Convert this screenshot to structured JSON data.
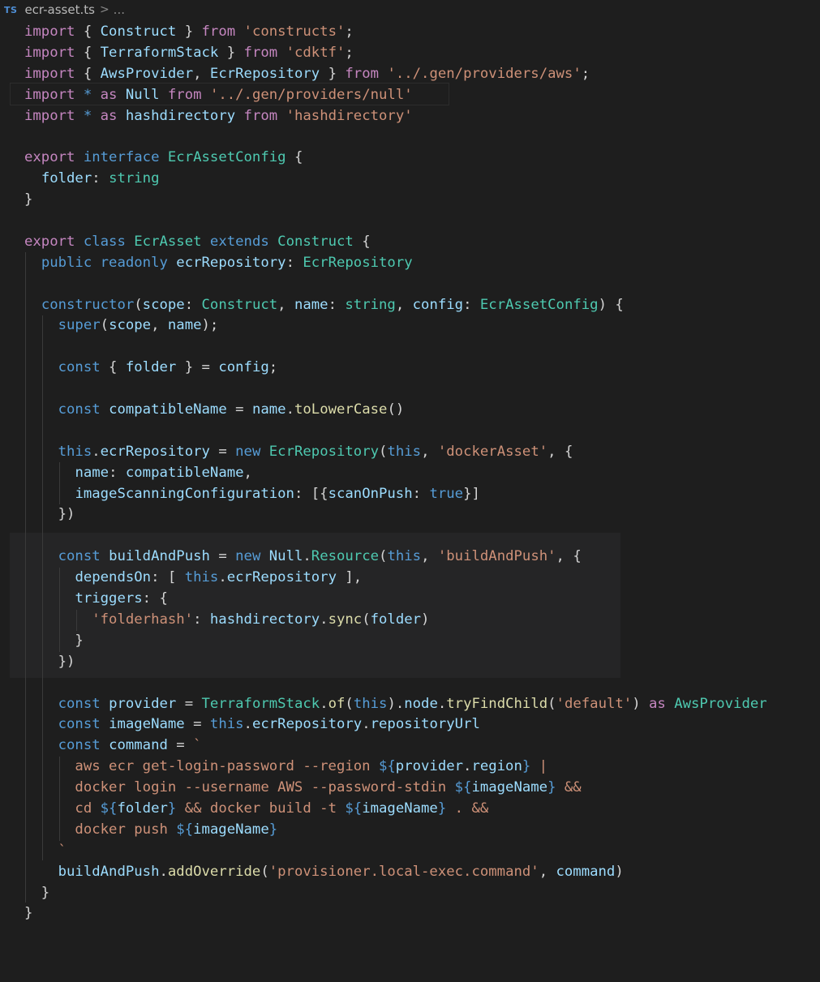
{
  "breadcrumb": {
    "badge": "TS",
    "file": "ecr-asset.ts",
    "separator": ">",
    "more": "..."
  },
  "colors": {
    "background": "#1e1e1e",
    "keyword_control": "#c586c0",
    "keyword": "#569cd6",
    "type": "#4ec9b0",
    "variable": "#9cdcfe",
    "string": "#ce9178",
    "function": "#dcdcaa",
    "punctuation": "#d4d4d4"
  },
  "code": [
    [
      [
        "kw-import",
        "import"
      ],
      [
        "punct",
        " { "
      ],
      [
        "var",
        "Construct"
      ],
      [
        "punct",
        " } "
      ],
      [
        "kw-import",
        "from"
      ],
      [
        "punct",
        " "
      ],
      [
        "str",
        "'constructs'"
      ],
      [
        "punct",
        ";"
      ]
    ],
    [
      [
        "kw-import",
        "import"
      ],
      [
        "punct",
        " { "
      ],
      [
        "var",
        "TerraformStack"
      ],
      [
        "punct",
        " } "
      ],
      [
        "kw-import",
        "from"
      ],
      [
        "punct",
        " "
      ],
      [
        "str",
        "'cdktf'"
      ],
      [
        "punct",
        ";"
      ]
    ],
    [
      [
        "kw-import",
        "import"
      ],
      [
        "punct",
        " { "
      ],
      [
        "var",
        "AwsProvider"
      ],
      [
        "punct",
        ", "
      ],
      [
        "var",
        "EcrRepository"
      ],
      [
        "punct",
        " } "
      ],
      [
        "kw-import",
        "from"
      ],
      [
        "punct",
        " "
      ],
      [
        "str",
        "'../.gen/providers/aws'"
      ],
      [
        "punct",
        ";"
      ]
    ],
    [
      [
        "kw-import",
        "import"
      ],
      [
        "punct",
        " "
      ],
      [
        "kw",
        "*"
      ],
      [
        "punct",
        " "
      ],
      [
        "kw-import",
        "as"
      ],
      [
        "punct",
        " "
      ],
      [
        "var",
        "Null"
      ],
      [
        "punct",
        " "
      ],
      [
        "kw-import",
        "from"
      ],
      [
        "punct",
        " "
      ],
      [
        "str",
        "'../.gen/providers/null'"
      ]
    ],
    [
      [
        "kw-import",
        "import"
      ],
      [
        "punct",
        " "
      ],
      [
        "kw",
        "*"
      ],
      [
        "punct",
        " "
      ],
      [
        "kw-import",
        "as"
      ],
      [
        "punct",
        " "
      ],
      [
        "var",
        "hashdirectory"
      ],
      [
        "punct",
        " "
      ],
      [
        "kw-import",
        "from"
      ],
      [
        "punct",
        " "
      ],
      [
        "str",
        "'hashdirectory'"
      ]
    ],
    [],
    [
      [
        "kw-import",
        "export"
      ],
      [
        "punct",
        " "
      ],
      [
        "kw",
        "interface"
      ],
      [
        "punct",
        " "
      ],
      [
        "type",
        "EcrAssetConfig"
      ],
      [
        "punct",
        " {"
      ]
    ],
    [
      [
        "punct",
        "  "
      ],
      [
        "var",
        "folder"
      ],
      [
        "punct",
        ": "
      ],
      [
        "type",
        "string"
      ]
    ],
    [
      [
        "punct",
        "}"
      ]
    ],
    [],
    [
      [
        "kw-import",
        "export"
      ],
      [
        "punct",
        " "
      ],
      [
        "kw",
        "class"
      ],
      [
        "punct",
        " "
      ],
      [
        "type",
        "EcrAsset"
      ],
      [
        "punct",
        " "
      ],
      [
        "kw",
        "extends"
      ],
      [
        "punct",
        " "
      ],
      [
        "type",
        "Construct"
      ],
      [
        "punct",
        " {"
      ]
    ],
    [
      [
        "punct",
        "  "
      ],
      [
        "kw",
        "public"
      ],
      [
        "punct",
        " "
      ],
      [
        "kw",
        "readonly"
      ],
      [
        "punct",
        " "
      ],
      [
        "var",
        "ecrRepository"
      ],
      [
        "punct",
        ": "
      ],
      [
        "type",
        "EcrRepository"
      ]
    ],
    [],
    [
      [
        "punct",
        "  "
      ],
      [
        "kw",
        "constructor"
      ],
      [
        "punct",
        "("
      ],
      [
        "var",
        "scope"
      ],
      [
        "punct",
        ": "
      ],
      [
        "type",
        "Construct"
      ],
      [
        "punct",
        ", "
      ],
      [
        "var",
        "name"
      ],
      [
        "punct",
        ": "
      ],
      [
        "type",
        "string"
      ],
      [
        "punct",
        ", "
      ],
      [
        "var",
        "config"
      ],
      [
        "punct",
        ": "
      ],
      [
        "type",
        "EcrAssetConfig"
      ],
      [
        "punct",
        ") {"
      ]
    ],
    [
      [
        "punct",
        "    "
      ],
      [
        "kw",
        "super"
      ],
      [
        "punct",
        "("
      ],
      [
        "var",
        "scope"
      ],
      [
        "punct",
        ", "
      ],
      [
        "var",
        "name"
      ],
      [
        "punct",
        ");"
      ]
    ],
    [],
    [
      [
        "punct",
        "    "
      ],
      [
        "kw",
        "const"
      ],
      [
        "punct",
        " { "
      ],
      [
        "var",
        "folder"
      ],
      [
        "punct",
        " } = "
      ],
      [
        "var",
        "config"
      ],
      [
        "punct",
        ";"
      ]
    ],
    [],
    [
      [
        "punct",
        "    "
      ],
      [
        "kw",
        "const"
      ],
      [
        "punct",
        " "
      ],
      [
        "var",
        "compatibleName"
      ],
      [
        "punct",
        " = "
      ],
      [
        "var",
        "name"
      ],
      [
        "punct",
        "."
      ],
      [
        "fn",
        "toLowerCase"
      ],
      [
        "punct",
        "()"
      ]
    ],
    [],
    [
      [
        "punct",
        "    "
      ],
      [
        "kw",
        "this"
      ],
      [
        "punct",
        "."
      ],
      [
        "var",
        "ecrRepository"
      ],
      [
        "punct",
        " = "
      ],
      [
        "kw",
        "new"
      ],
      [
        "punct",
        " "
      ],
      [
        "type",
        "EcrRepository"
      ],
      [
        "punct",
        "("
      ],
      [
        "kw",
        "this"
      ],
      [
        "punct",
        ", "
      ],
      [
        "str",
        "'dockerAsset'"
      ],
      [
        "punct",
        ", {"
      ]
    ],
    [
      [
        "punct",
        "      "
      ],
      [
        "var",
        "name"
      ],
      [
        "punct",
        ": "
      ],
      [
        "var",
        "compatibleName"
      ],
      [
        "punct",
        ","
      ]
    ],
    [
      [
        "punct",
        "      "
      ],
      [
        "var",
        "imageScanningConfiguration"
      ],
      [
        "punct",
        ": [{"
      ],
      [
        "var",
        "scanOnPush"
      ],
      [
        "punct",
        ": "
      ],
      [
        "kw",
        "true"
      ],
      [
        "punct",
        "}]"
      ]
    ],
    [
      [
        "punct",
        "    })"
      ]
    ],
    [],
    [
      [
        "punct",
        "    "
      ],
      [
        "kw",
        "const"
      ],
      [
        "punct",
        " "
      ],
      [
        "var",
        "buildAndPush"
      ],
      [
        "punct",
        " = "
      ],
      [
        "kw",
        "new"
      ],
      [
        "punct",
        " "
      ],
      [
        "var",
        "Null"
      ],
      [
        "punct",
        "."
      ],
      [
        "type",
        "Resource"
      ],
      [
        "punct",
        "("
      ],
      [
        "kw",
        "this"
      ],
      [
        "punct",
        ", "
      ],
      [
        "str",
        "'buildAndPush'"
      ],
      [
        "punct",
        ", {"
      ]
    ],
    [
      [
        "punct",
        "      "
      ],
      [
        "var",
        "dependsOn"
      ],
      [
        "punct",
        ": [ "
      ],
      [
        "kw",
        "this"
      ],
      [
        "punct",
        "."
      ],
      [
        "var",
        "ecrRepository"
      ],
      [
        "punct",
        " ],"
      ]
    ],
    [
      [
        "punct",
        "      "
      ],
      [
        "var",
        "triggers"
      ],
      [
        "punct",
        ": {"
      ]
    ],
    [
      [
        "punct",
        "        "
      ],
      [
        "str",
        "'folderhash'"
      ],
      [
        "punct",
        ": "
      ],
      [
        "var",
        "hashdirectory"
      ],
      [
        "punct",
        "."
      ],
      [
        "fn",
        "sync"
      ],
      [
        "punct",
        "("
      ],
      [
        "var",
        "folder"
      ],
      [
        "punct",
        ")"
      ]
    ],
    [
      [
        "punct",
        "      }"
      ]
    ],
    [
      [
        "punct",
        "    })"
      ]
    ],
    [],
    [
      [
        "punct",
        "    "
      ],
      [
        "kw",
        "const"
      ],
      [
        "punct",
        " "
      ],
      [
        "var",
        "provider"
      ],
      [
        "punct",
        " = "
      ],
      [
        "type",
        "TerraformStack"
      ],
      [
        "punct",
        "."
      ],
      [
        "fn",
        "of"
      ],
      [
        "punct",
        "("
      ],
      [
        "kw",
        "this"
      ],
      [
        "punct",
        ")."
      ],
      [
        "var",
        "node"
      ],
      [
        "punct",
        "."
      ],
      [
        "fn",
        "tryFindChild"
      ],
      [
        "punct",
        "("
      ],
      [
        "str",
        "'default'"
      ],
      [
        "punct",
        ") "
      ],
      [
        "kw-import",
        "as"
      ],
      [
        "punct",
        " "
      ],
      [
        "type",
        "AwsProvider"
      ]
    ],
    [
      [
        "punct",
        "    "
      ],
      [
        "kw",
        "const"
      ],
      [
        "punct",
        " "
      ],
      [
        "var",
        "imageName"
      ],
      [
        "punct",
        " = "
      ],
      [
        "kw",
        "this"
      ],
      [
        "punct",
        "."
      ],
      [
        "var",
        "ecrRepository"
      ],
      [
        "punct",
        "."
      ],
      [
        "var",
        "repositoryUrl"
      ]
    ],
    [
      [
        "punct",
        "    "
      ],
      [
        "kw",
        "const"
      ],
      [
        "punct",
        " "
      ],
      [
        "var",
        "command"
      ],
      [
        "punct",
        " = "
      ],
      [
        "str",
        "`"
      ]
    ],
    [
      [
        "str",
        "      aws ecr get-login-password --region "
      ],
      [
        "kw",
        "${"
      ],
      [
        "var",
        "provider"
      ],
      [
        "punct",
        "."
      ],
      [
        "var",
        "region"
      ],
      [
        "kw",
        "}"
      ],
      [
        "str",
        " |"
      ]
    ],
    [
      [
        "str",
        "      docker login --username AWS --password-stdin "
      ],
      [
        "kw",
        "${"
      ],
      [
        "var",
        "imageName"
      ],
      [
        "kw",
        "}"
      ],
      [
        "str",
        " &&"
      ]
    ],
    [
      [
        "str",
        "      cd "
      ],
      [
        "kw",
        "${"
      ],
      [
        "var",
        "folder"
      ],
      [
        "kw",
        "}"
      ],
      [
        "str",
        " && docker build -t "
      ],
      [
        "kw",
        "${"
      ],
      [
        "var",
        "imageName"
      ],
      [
        "kw",
        "}"
      ],
      [
        "str",
        " . &&"
      ]
    ],
    [
      [
        "str",
        "      docker push "
      ],
      [
        "kw",
        "${"
      ],
      [
        "var",
        "imageName"
      ],
      [
        "kw",
        "}"
      ]
    ],
    [
      [
        "str",
        "    `"
      ]
    ],
    [
      [
        "punct",
        "    "
      ],
      [
        "var",
        "buildAndPush"
      ],
      [
        "punct",
        "."
      ],
      [
        "fn",
        "addOverride"
      ],
      [
        "punct",
        "("
      ],
      [
        "str",
        "'provisioner.local-exec.command'"
      ],
      [
        "punct",
        ", "
      ],
      [
        "var",
        "command"
      ],
      [
        "punct",
        ")"
      ]
    ],
    [
      [
        "punct",
        "  }"
      ]
    ],
    [
      [
        "punct",
        "}"
      ]
    ]
  ]
}
